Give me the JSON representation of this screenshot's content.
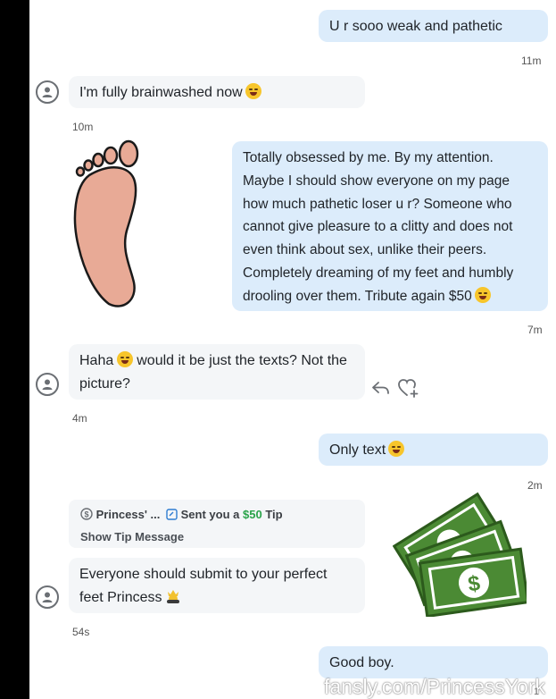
{
  "messages": {
    "m1": {
      "text": "U r sooo weak and pathetic",
      "time": "11m"
    },
    "m2": {
      "text": "I'm fully brainwashed now",
      "emoji": "tears-of-joy",
      "time": "10m"
    },
    "m3": {
      "lines": [
        "Totally obsessed by me. By my attention.",
        "Maybe I should show everyone on my page",
        "how much pathetic loser u r? Someone who",
        "cannot give pleasure to a clitty and does not",
        "even think about sex, unlike their peers.",
        "Completely dreaming of my feet and humbly",
        "drooling over them. Tribute again $50"
      ],
      "emoji": "tears-of-joy",
      "time": "7m"
    },
    "m4": {
      "text_a": "Haha",
      "text_b": "would it be just the texts? Not the",
      "text_c": "picture?",
      "emoji": "sweat-smile",
      "time": "4m"
    },
    "m5": {
      "text": "Only text",
      "emoji": "tears-of-joy",
      "time": "2m"
    },
    "tip": {
      "sender": "Princess' ...",
      "sent": "Sent you a",
      "amount": "$50",
      "tip_word": "Tip",
      "show": "Show Tip Message"
    },
    "m6": {
      "line1": "Everyone should submit to your perfect",
      "line2": "feet Princess",
      "emoji": "crown-bow",
      "time": "54s"
    },
    "m7": {
      "text": "Good boy."
    }
  },
  "icons": [
    "avatar-icon",
    "reply-icon",
    "heart-plus-icon",
    "dollar-circle-icon",
    "tip-note-icon",
    "foot-sticker",
    "money-sticker"
  ],
  "colors": {
    "outgoing": "#dcecfb",
    "incoming": "#f4f6f8",
    "tip_green": "#2aa34a",
    "money_green": "#3d7f2a",
    "foot": "#e8aa96"
  },
  "watermark": "fansly.com/PrincessYork",
  "corner_text": "1 "
}
